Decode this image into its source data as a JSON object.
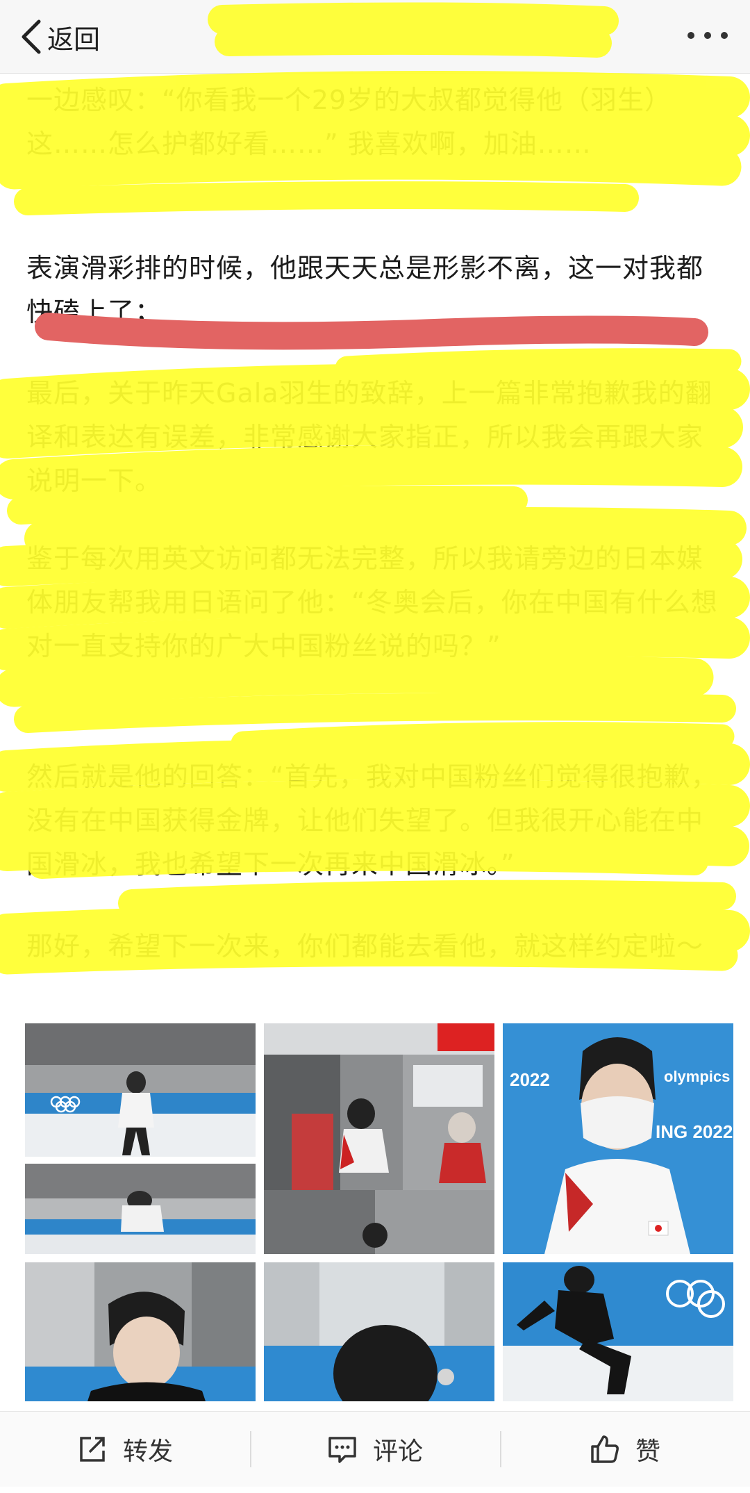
{
  "header": {
    "back_label": "返回"
  },
  "post": {
    "paragraphs": [
      "一边感叹：“你看我一个29岁的大叔都觉得他（羽生）这……怎么护都好看……” 我喜欢啊，加油……",
      "表演滑彩排的时候，他跟天天总是形影不离，这一对我都快磕上了；",
      "最后，关于昨天Gala羽生的致辞，上一篇非常抱歉我的翻译和表达有误差，非常感谢大家指正，所以我会再跟大家说明一下。",
      "鉴于每次用英文访问都无法完整，所以我请旁边的日本媒体朋友帮我用日语问了他：“冬奥会后，你在中国有什么想对一直支持你的广大中国粉丝说的吗？”",
      "然后就是他的回答：“首先，我对中国粉丝们觉得很抱歉，没有在中国获得金牌，让他们失望了。但我很开心能在中国滑冰，我也希望下一次再来中国滑冰。”",
      "那好，希望下一次来，你们都能去看他，就这样约定啦～"
    ]
  },
  "photos": [
    {
      "name": "photo-practice-rink"
    },
    {
      "name": "photo-hallway-coach"
    },
    {
      "name": "photo-mask-portrait"
    },
    {
      "name": "photo-head-down"
    },
    {
      "name": "photo-back-of-head"
    },
    {
      "name": "photo-skating-pose"
    }
  ],
  "actions": {
    "repost_label": "转发",
    "comment_label": "评论",
    "like_label": "赞"
  },
  "colors": {
    "highlighter": "#ffff2e",
    "pen_stroke": "#e26463",
    "topbar_bg": "#f7f7f7",
    "photo_blue": "#2f8ad0"
  },
  "icons": [
    "back-chevron-icon",
    "more-dots-icon",
    "repost-icon",
    "comment-icon",
    "like-icon"
  ]
}
